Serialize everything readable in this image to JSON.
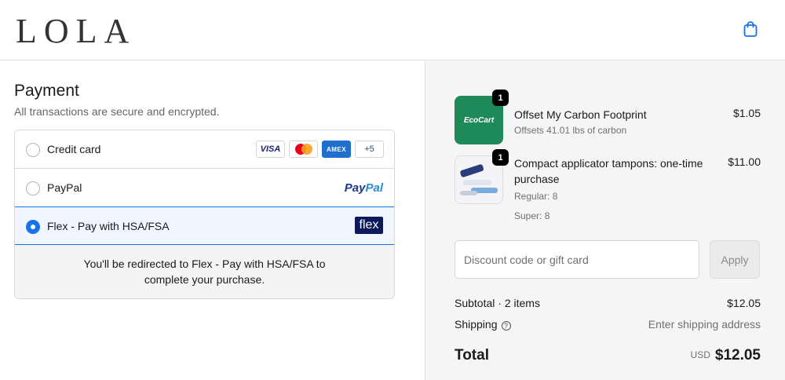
{
  "header": {
    "logo": "LOLA",
    "cart_icon": "shopping-bag-icon"
  },
  "payment": {
    "title": "Payment",
    "subtitle": "All transactions are secure and encrypted.",
    "methods": [
      {
        "label": "Credit card",
        "selected": false
      },
      {
        "label": "PayPal",
        "selected": false
      },
      {
        "label": "Flex - Pay with HSA/FSA",
        "selected": true
      }
    ],
    "cards": {
      "visa": "VISA",
      "amex": "AMEX",
      "more": "+5"
    },
    "paypal_logo_a": "Pay",
    "paypal_logo_b": "Pal",
    "flex_logo": "flex",
    "redirect_line1": "You'll be redirected to Flex - Pay with HSA/FSA to",
    "redirect_line2": "complete your purchase."
  },
  "order": {
    "items": [
      {
        "name": "Offset My Carbon Footprint",
        "sub": "Offsets 41.01 lbs of carbon",
        "price": "$1.05",
        "qty": "1",
        "thumb_text": "EcoCart"
      },
      {
        "name": "Compact applicator tampons: one-time purchase",
        "sub1": "Regular: 8",
        "sub2": "Super: 8",
        "price": "$11.00",
        "qty": "1"
      }
    ],
    "discount_placeholder": "Discount code or gift card",
    "apply_label": "Apply",
    "subtotal_label": "Subtotal · 2 items",
    "subtotal_value": "$12.05",
    "shipping_label": "Shipping",
    "shipping_value": "Enter shipping address",
    "total_label": "Total",
    "total_currency": "USD",
    "total_value": "$12.05"
  },
  "colors": {
    "accent": "#1773e8",
    "ecocart_green": "#1e8a5a",
    "flex_navy": "#0c1a5c"
  }
}
